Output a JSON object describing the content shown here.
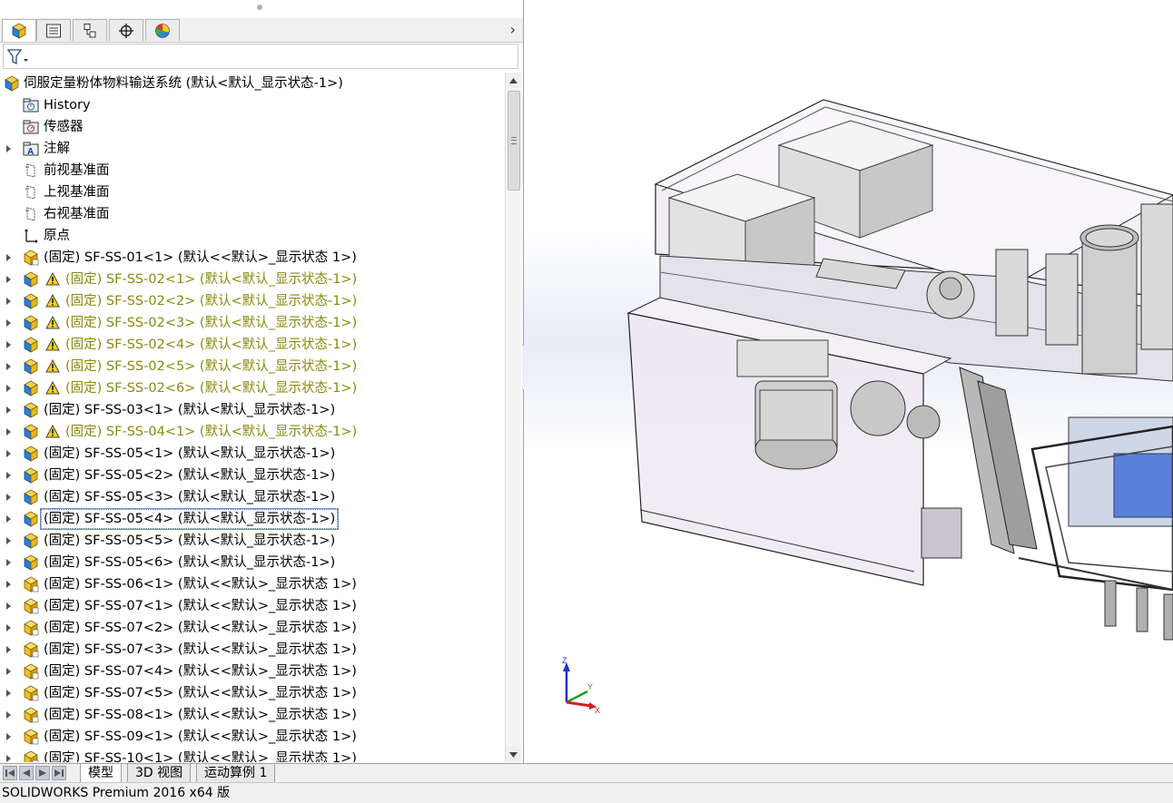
{
  "panel_tabs": [
    {
      "name": "feature-manager-tab",
      "icon": "assembly-cube-icon"
    },
    {
      "name": "property-manager-tab",
      "icon": "property-list-icon"
    },
    {
      "name": "configuration-manager-tab",
      "icon": "configuration-icon"
    },
    {
      "name": "dimxpert-tab",
      "icon": "crosshair-icon"
    },
    {
      "name": "display-manager-tab",
      "icon": "color-wheel-icon"
    }
  ],
  "tree": {
    "root": {
      "label": "伺服定量粉体物料输送系统 (默认<默认_显示状态-1>)"
    },
    "items": [
      {
        "label": "History",
        "icon": "history-folder-icon",
        "expander": false,
        "warning": false
      },
      {
        "label": "传感器",
        "icon": "sensor-folder-icon",
        "expander": false,
        "warning": false
      },
      {
        "label": "注解",
        "icon": "annotation-folder-icon",
        "expander": true,
        "warning": false
      },
      {
        "label": "前视基准面",
        "icon": "plane-icon",
        "expander": false,
        "warning": false
      },
      {
        "label": "上视基准面",
        "icon": "plane-icon",
        "expander": false,
        "warning": false
      },
      {
        "label": "右视基准面",
        "icon": "plane-icon",
        "expander": false,
        "warning": false
      },
      {
        "label": "原点",
        "icon": "origin-icon",
        "expander": false,
        "warning": false
      },
      {
        "label": "(固定) SF-SS-01<1> (默认<<默认>_显示状态 1>)",
        "icon": "part-icon",
        "expander": true,
        "warning": false
      },
      {
        "label": "(固定) SF-SS-02<1> (默认<默认_显示状态-1>)",
        "icon": "subassembly-icon",
        "expander": true,
        "warning": true
      },
      {
        "label": "(固定) SF-SS-02<2> (默认<默认_显示状态-1>)",
        "icon": "subassembly-icon",
        "expander": true,
        "warning": true
      },
      {
        "label": "(固定) SF-SS-02<3> (默认<默认_显示状态-1>)",
        "icon": "subassembly-icon",
        "expander": true,
        "warning": true
      },
      {
        "label": "(固定) SF-SS-02<4> (默认<默认_显示状态-1>)",
        "icon": "subassembly-icon",
        "expander": true,
        "warning": true
      },
      {
        "label": "(固定) SF-SS-02<5> (默认<默认_显示状态-1>)",
        "icon": "subassembly-icon",
        "expander": true,
        "warning": true
      },
      {
        "label": "(固定) SF-SS-02<6> (默认<默认_显示状态-1>)",
        "icon": "subassembly-icon",
        "expander": true,
        "warning": true
      },
      {
        "label": "(固定) SF-SS-03<1> (默认<默认_显示状态-1>)",
        "icon": "subassembly-icon",
        "expander": true,
        "warning": false
      },
      {
        "label": "(固定) SF-SS-04<1> (默认<默认_显示状态-1>)",
        "icon": "subassembly-icon",
        "expander": true,
        "warning": true
      },
      {
        "label": "(固定) SF-SS-05<1> (默认<默认_显示状态-1>)",
        "icon": "subassembly-icon",
        "expander": true,
        "warning": false
      },
      {
        "label": "(固定) SF-SS-05<2> (默认<默认_显示状态-1>)",
        "icon": "subassembly-icon",
        "expander": true,
        "warning": false
      },
      {
        "label": "(固定) SF-SS-05<3> (默认<默认_显示状态-1>)",
        "icon": "subassembly-icon",
        "expander": true,
        "warning": false
      },
      {
        "label": "(固定) SF-SS-05<4> (默认<默认_显示状态-1>)",
        "icon": "subassembly-icon",
        "expander": true,
        "warning": false,
        "selected": true
      },
      {
        "label": "(固定) SF-SS-05<5> (默认<默认_显示状态-1>)",
        "icon": "subassembly-icon",
        "expander": true,
        "warning": false
      },
      {
        "label": "(固定) SF-SS-05<6> (默认<默认_显示状态-1>)",
        "icon": "subassembly-icon",
        "expander": true,
        "warning": false
      },
      {
        "label": "(固定) SF-SS-06<1> (默认<<默认>_显示状态 1>)",
        "icon": "part-icon",
        "expander": true,
        "warning": false
      },
      {
        "label": "(固定) SF-SS-07<1> (默认<<默认>_显示状态 1>)",
        "icon": "part-icon",
        "expander": true,
        "warning": false
      },
      {
        "label": "(固定) SF-SS-07<2> (默认<<默认>_显示状态 1>)",
        "icon": "part-icon",
        "expander": true,
        "warning": false
      },
      {
        "label": "(固定) SF-SS-07<3> (默认<<默认>_显示状态 1>)",
        "icon": "part-icon",
        "expander": true,
        "warning": false
      },
      {
        "label": "(固定) SF-SS-07<4> (默认<<默认>_显示状态 1>)",
        "icon": "part-icon",
        "expander": true,
        "warning": false
      },
      {
        "label": "(固定) SF-SS-07<5> (默认<<默认>_显示状态 1>)",
        "icon": "part-icon",
        "expander": true,
        "warning": false
      },
      {
        "label": "(固定) SF-SS-08<1> (默认<<默认>_显示状态 1>)",
        "icon": "part-icon",
        "expander": true,
        "warning": false
      },
      {
        "label": "(固定) SF-SS-09<1> (默认<<默认>_显示状态 1>)",
        "icon": "part-icon",
        "expander": true,
        "warning": false
      },
      {
        "label": "(固定) SF-SS-10<1> (默认<<默认>_显示状态 1>)",
        "icon": "part-icon",
        "expander": true,
        "warning": false
      }
    ]
  },
  "bottom_tabs": [
    {
      "label": "模型",
      "active": true
    },
    {
      "label": "3D 视图",
      "active": false
    },
    {
      "label": "运动算例 1",
      "active": false
    }
  ],
  "status_bar": {
    "text": "SOLIDWORKS Premium 2016 x64 版"
  },
  "triad": {
    "z": "Z",
    "y": "Y",
    "x": "X"
  },
  "colors": {
    "warning_text": "#8a8a10",
    "part_icon": "#f2c018",
    "assembly_icon": "#2c7fd8"
  }
}
